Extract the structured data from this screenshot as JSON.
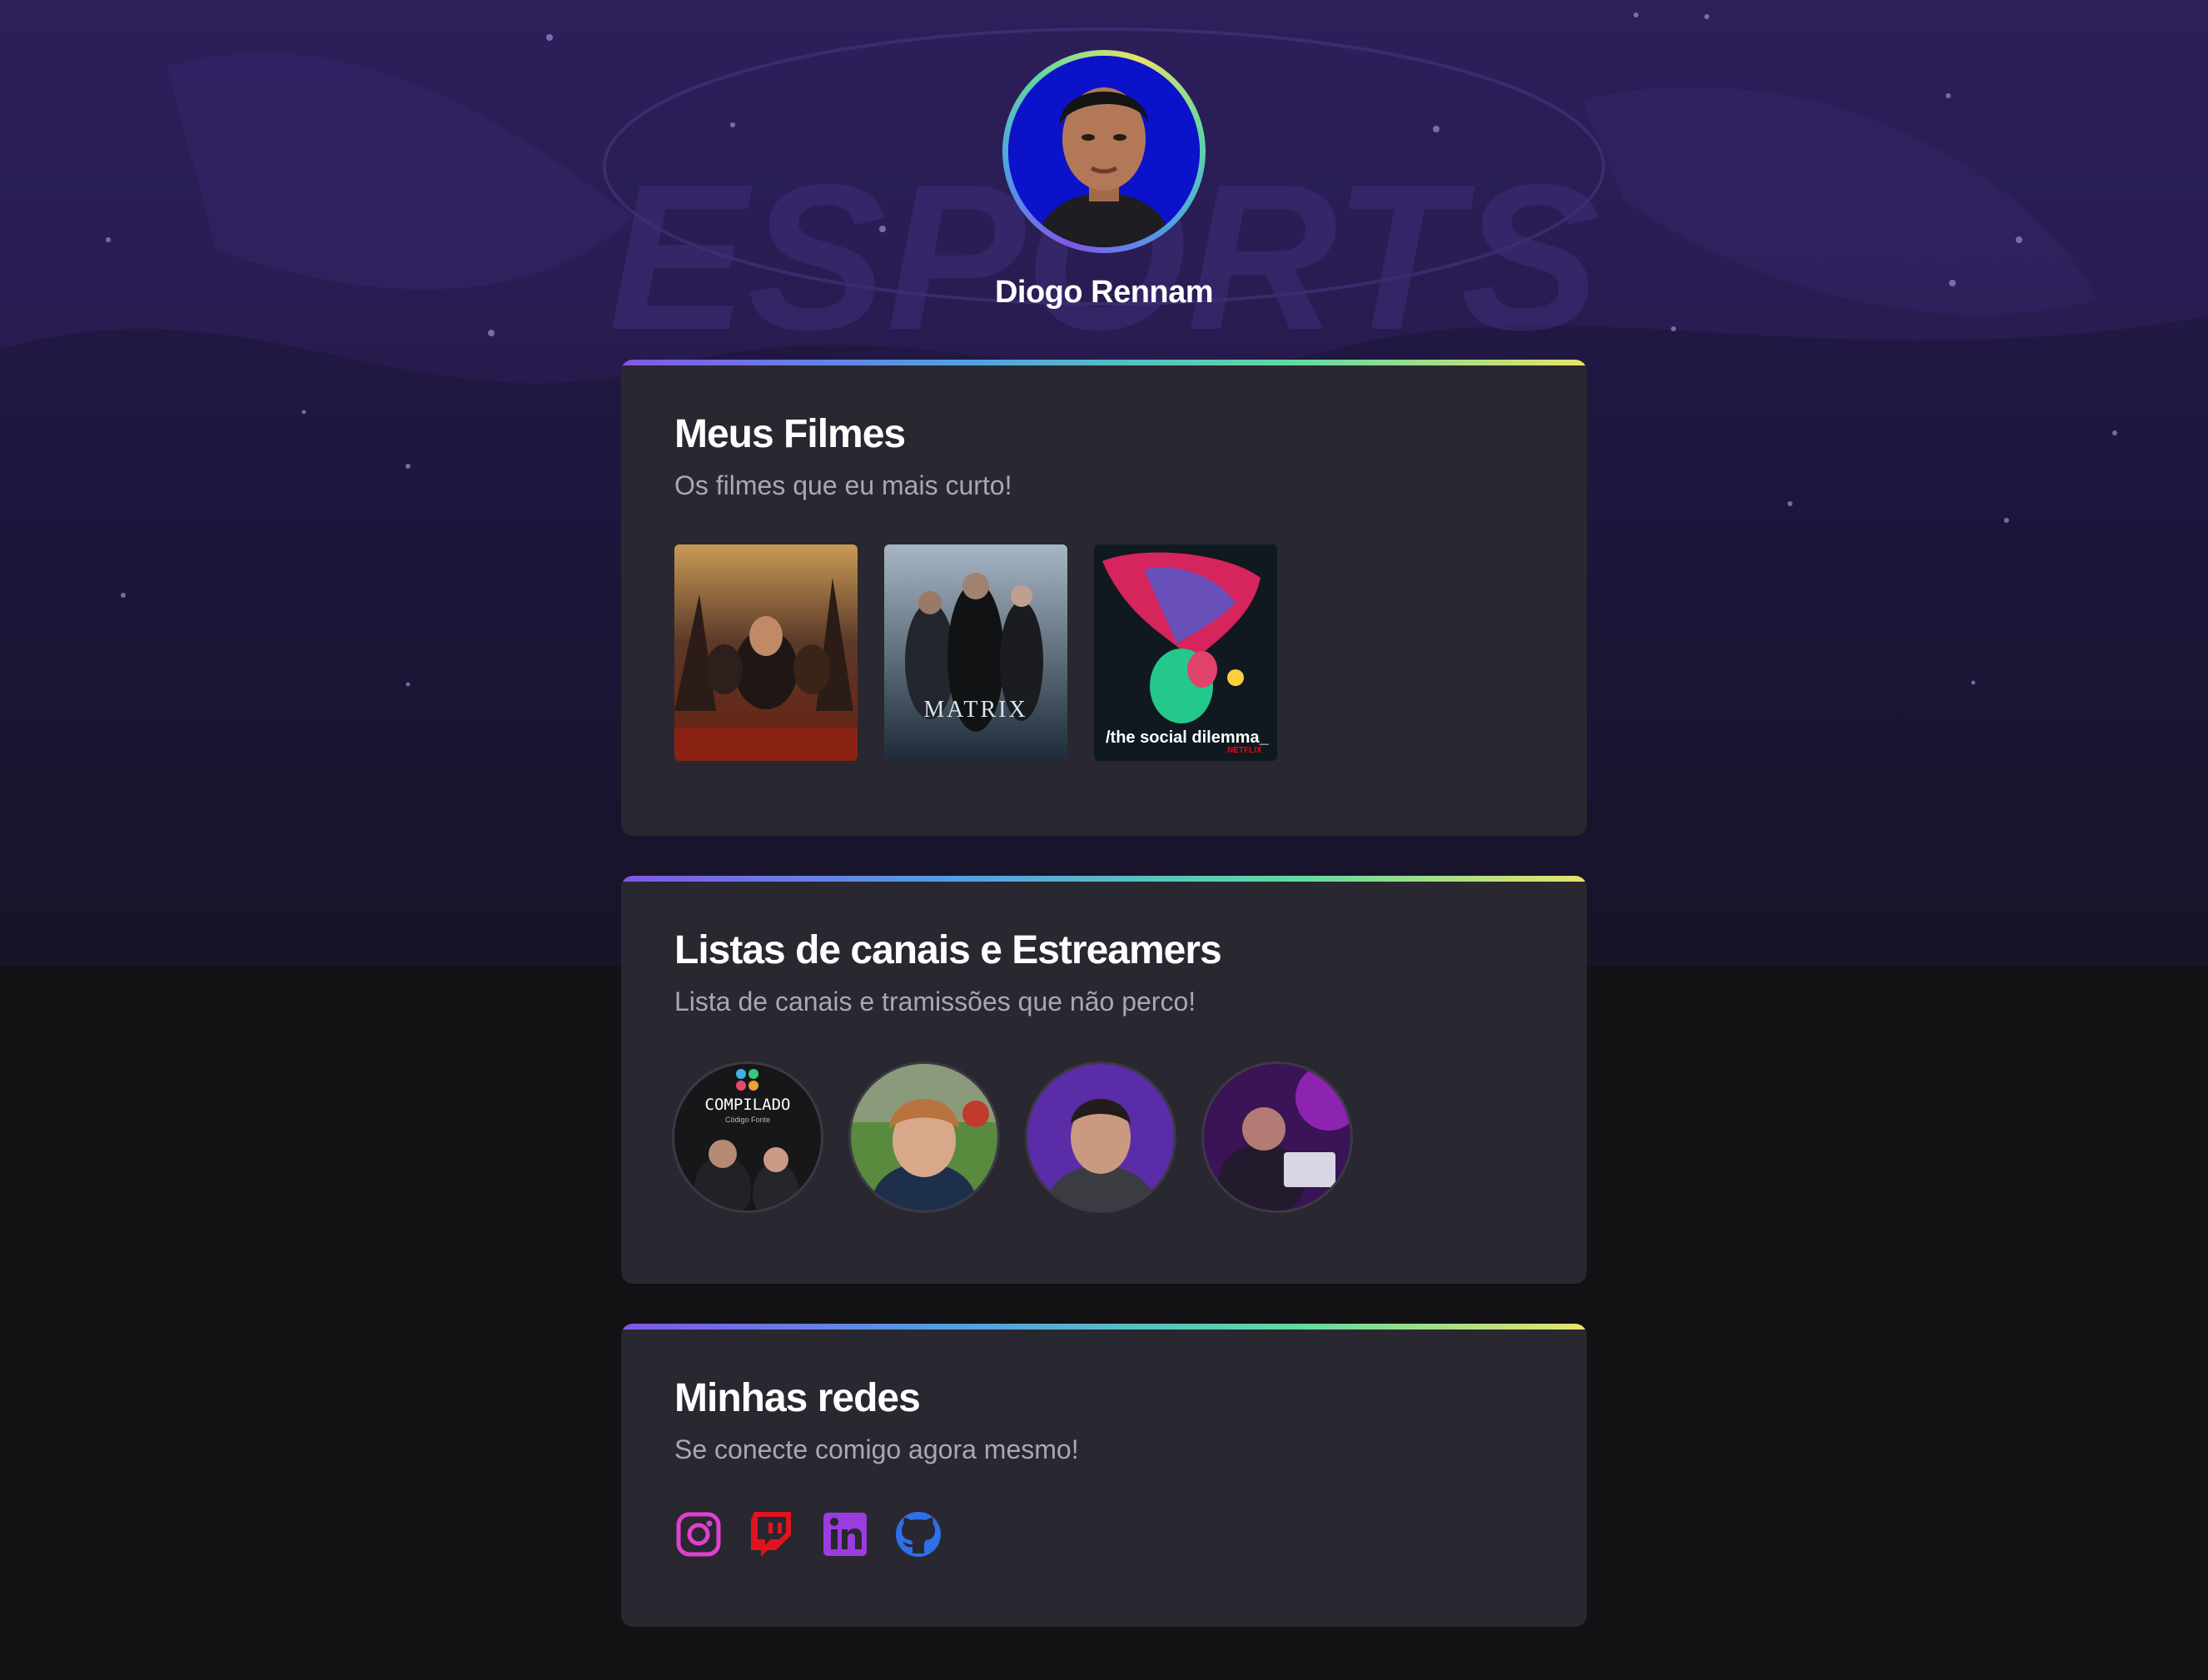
{
  "profile": {
    "name": "Diogo Rennam",
    "avatar_alt": "Foto de perfil"
  },
  "films_card": {
    "title": "Meus Filmes",
    "subtitle": "Os filmes que eu mais curto!",
    "posters": [
      {
        "caption": ""
      },
      {
        "caption": "MATRIX"
      },
      {
        "caption": "/the social dilemma_",
        "badge": "NETFLIX"
      }
    ]
  },
  "channels_card": {
    "title": "Listas de canais e Estreamers",
    "subtitle": "Lista de canais e tramissões que não perco!",
    "channels": [
      {
        "caption": "COMPILADO",
        "sub": "Código Fonte"
      },
      {
        "caption": ""
      },
      {
        "caption": ""
      },
      {
        "caption": ""
      }
    ]
  },
  "socials_card": {
    "title": "Minhas redes",
    "subtitle": "Se conecte comigo agora mesmo!",
    "links": [
      {
        "icon": "instagram-icon",
        "color": "#e040d0"
      },
      {
        "icon": "twitch-icon",
        "color": "#e1131f"
      },
      {
        "icon": "linkedin-icon",
        "color": "#9b3ce0"
      },
      {
        "icon": "github-icon",
        "color": "#2f6fe8"
      }
    ]
  },
  "colors": {
    "background": "#121214",
    "card": "#29272f",
    "gradient": [
      "#8257e5",
      "#4fa0e5",
      "#61d9a0",
      "#e8e36a"
    ]
  },
  "background_art": {
    "text": "ESPORTS"
  }
}
